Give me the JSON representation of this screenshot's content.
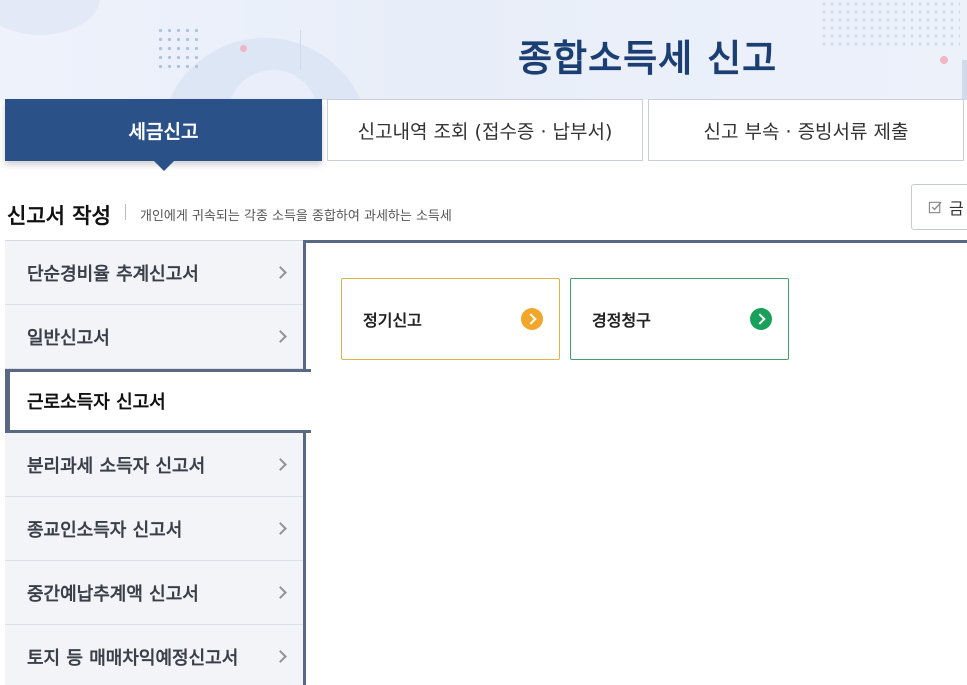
{
  "header": {
    "title": "종합소득세  신고"
  },
  "tabs": [
    {
      "label": "세금신고",
      "active": true
    },
    {
      "label": "신고내역 조회 (접수증 · 납부서)",
      "active": false
    },
    {
      "label": "신고 부속 · 증빙서류 제출",
      "active": false
    }
  ],
  "section": {
    "title": "신고서 작성",
    "description": "개인에게 귀속되는 각종 소득을 종합하여 과세하는 소득세",
    "side_button_label": "금"
  },
  "menu": {
    "items": [
      {
        "label": "단순경비율 추계신고서"
      },
      {
        "label": "일반신고서"
      },
      {
        "label": "근로소득자 신고서",
        "active": true
      },
      {
        "label": "분리과세 소득자 신고서"
      },
      {
        "label": "종교인소득자 신고서"
      },
      {
        "label": "중간예납추계액 신고서"
      },
      {
        "label": "토지 등 매매차익예정신고서"
      }
    ]
  },
  "cards": [
    {
      "label": "정기신고",
      "accent": "#f2a72a"
    },
    {
      "label": "경정청구",
      "accent": "#19a05b"
    }
  ],
  "colors": {
    "primary": "#2a5188",
    "title": "#1c3f73",
    "menu_border": "#5b6883"
  }
}
